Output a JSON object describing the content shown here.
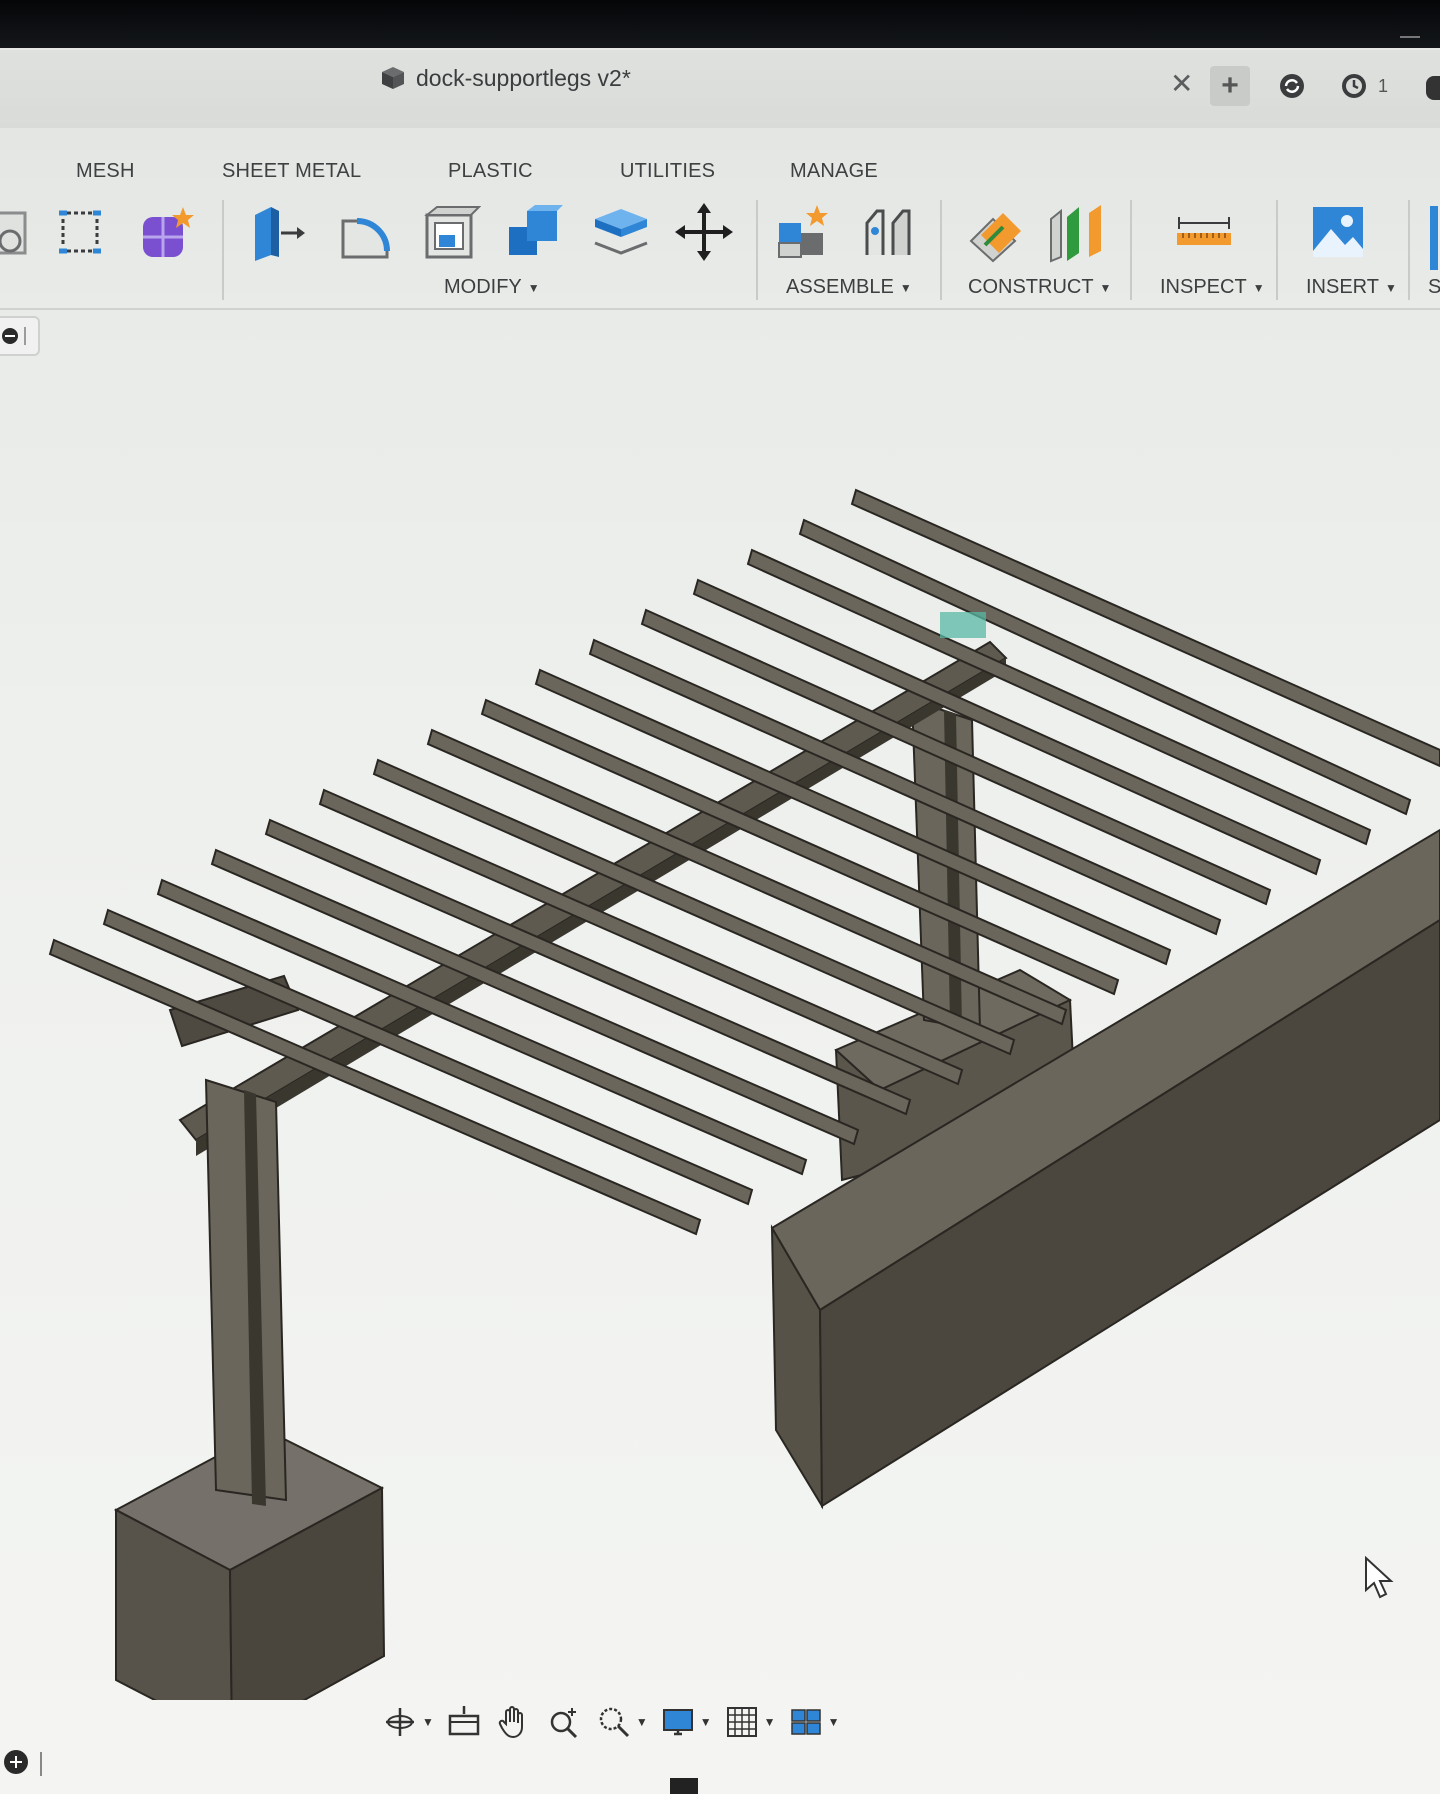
{
  "document": {
    "title": "dock-supportlegs v2*",
    "job_count": "1"
  },
  "tabs": [
    {
      "label": "MESH"
    },
    {
      "label": "SHEET METAL"
    },
    {
      "label": "PLASTIC"
    },
    {
      "label": "UTILITIES"
    },
    {
      "label": "MANAGE"
    }
  ],
  "groups": {
    "modify": "MODIFY",
    "assemble": "ASSEMBLE",
    "construct": "CONSTRUCT",
    "inspect": "INSPECT",
    "insert": "INSERT",
    "select_partial": "S"
  },
  "icons": {
    "tab_close": "close-icon",
    "tab_new": "plus-icon",
    "sync": "sync-icon",
    "jobs": "clock-icon",
    "notifications": "bell-icon"
  },
  "colors": {
    "accent_blue": "#2f86d6",
    "orange": "#f29a2e",
    "purple": "#7a4fd0",
    "model_gray": "#5f5a50"
  }
}
